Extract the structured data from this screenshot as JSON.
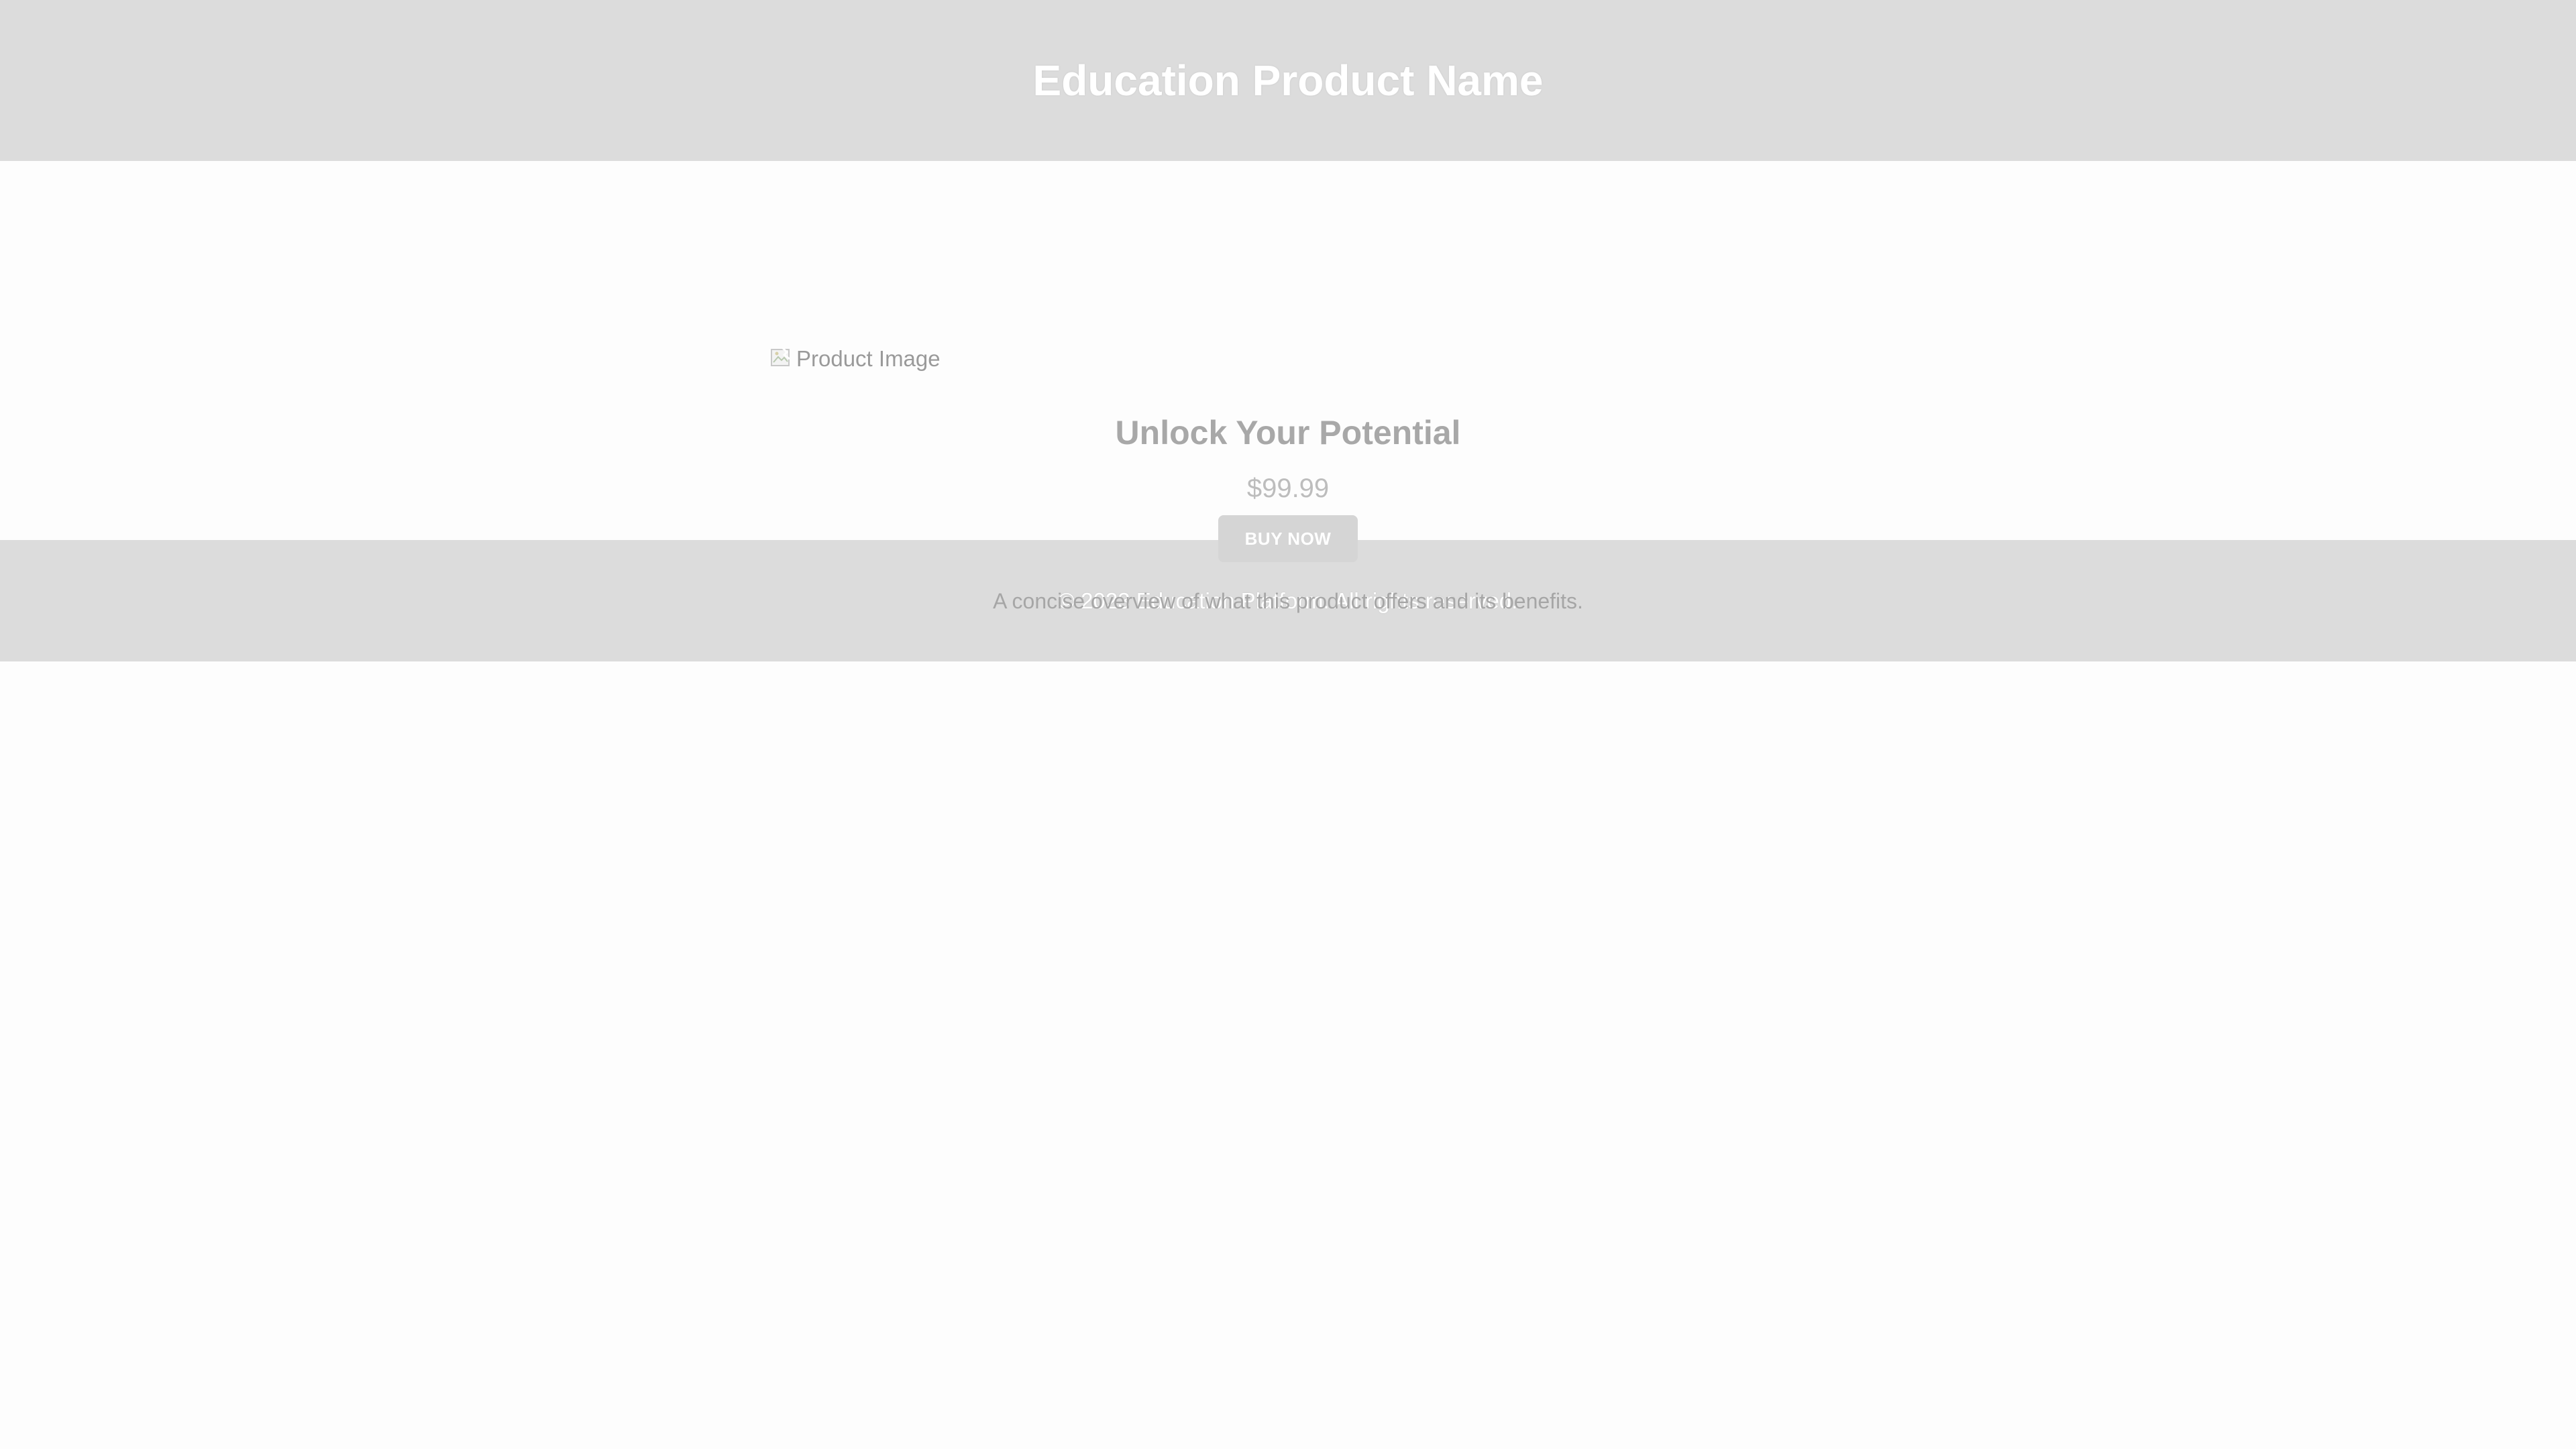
{
  "header": {
    "title": "Education Product Name"
  },
  "product": {
    "image_alt": "Product Image",
    "image_icon": "broken-image-icon",
    "tagline": "Unlock Your Potential",
    "price": "$99.99",
    "buy_label": "BUY NOW",
    "description": "A concise overview of what this product offers and its benefits."
  },
  "footer": {
    "copyright": "© 2023 Education Platform. All rights reserved."
  },
  "colors": {
    "header_bg": "#dcdcdc",
    "footer_bg": "#dcdcdc",
    "button_bg": "#d5d5d5",
    "page_bg": "#fdfdfd"
  }
}
